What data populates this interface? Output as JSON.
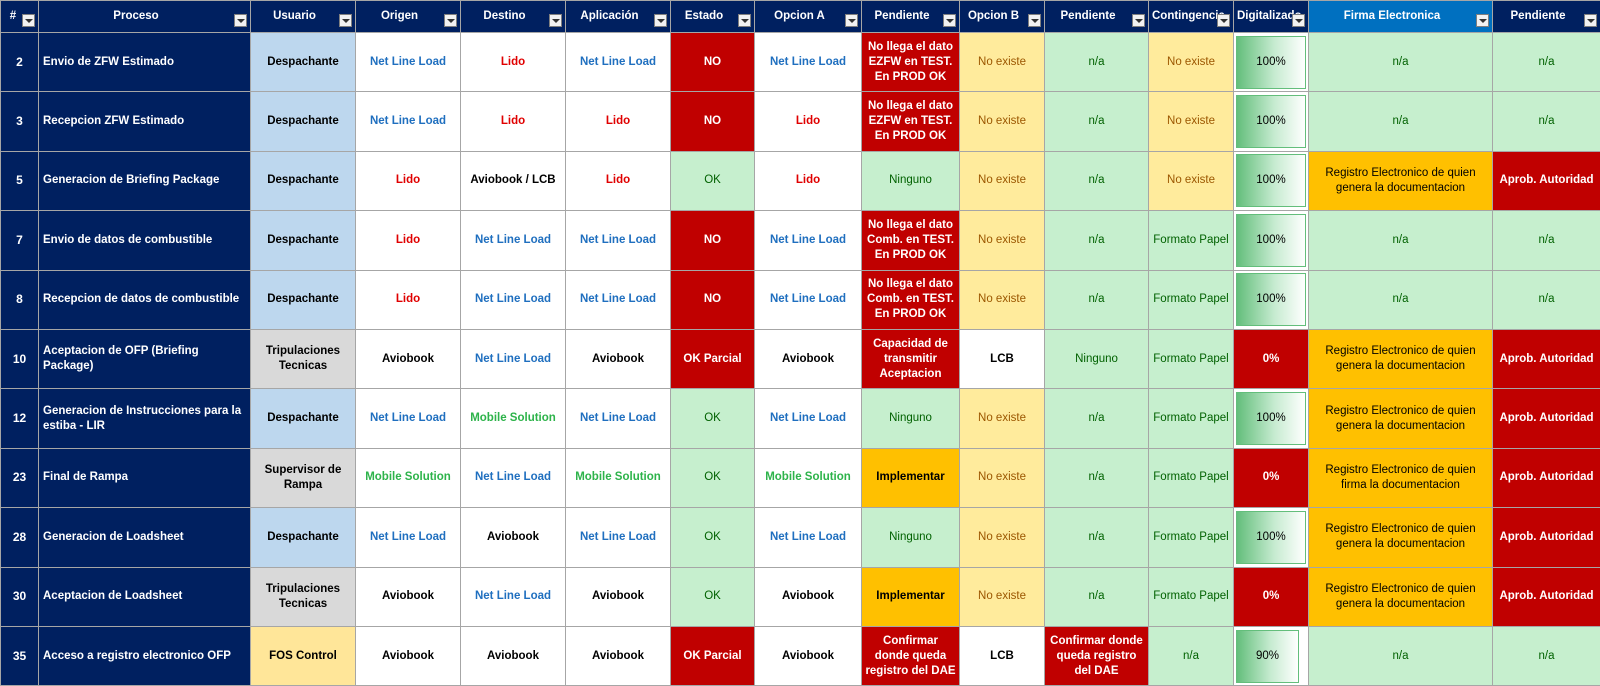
{
  "headers": {
    "num": "#",
    "proceso": "Proceso",
    "usuario": "Usuario",
    "origen": "Origen",
    "destino": "Destino",
    "aplicacion": "Aplicación",
    "estado": "Estado",
    "opcion_a": "Opcion A",
    "pendiente1": "Pendiente",
    "opcion_b": "Opcion B",
    "pendiente2": "Pendiente",
    "contingencia": "Contingencia",
    "digitalizado": "Digitalizado",
    "firma": "Firma Electronica",
    "pendiente3": "Pendiente"
  },
  "rows": [
    {
      "num": "2",
      "proceso": "Envio de ZFW Estimado",
      "usuario": "Despachante",
      "origen": "Net Line Load",
      "destino": "Lido",
      "aplicacion": "Net Line Load",
      "estado": "NO",
      "opcion_a": "Net Line Load",
      "pendiente1": "No llega el dato EZFW en TEST. En PROD OK",
      "opcion_b": "No existe",
      "pendiente2": "n/a",
      "contingencia": "No existe",
      "digitalizado": "100%",
      "firma": "n/a",
      "pendiente3": "n/a"
    },
    {
      "num": "3",
      "proceso": "Recepcion ZFW Estimado",
      "usuario": "Despachante",
      "origen": "Net Line Load",
      "destino": "Lido",
      "aplicacion": "Lido",
      "estado": "NO",
      "opcion_a": "Lido",
      "pendiente1": "No llega el dato EZFW en TEST. En PROD OK",
      "opcion_b": "No existe",
      "pendiente2": "n/a",
      "contingencia": "No existe",
      "digitalizado": "100%",
      "firma": "n/a",
      "pendiente3": "n/a"
    },
    {
      "num": "5",
      "proceso": "Generacion de Briefing Package",
      "usuario": "Despachante",
      "origen": "Lido",
      "destino": "Aviobook / LCB",
      "aplicacion": "Lido",
      "estado": "OK",
      "opcion_a": "Lido",
      "pendiente1": "Ninguno",
      "opcion_b": "No existe",
      "pendiente2": "n/a",
      "contingencia": "No existe",
      "digitalizado": "100%",
      "firma": "Registro Electronico de quien genera la documentacion",
      "pendiente3": "Aprob. Autoridad"
    },
    {
      "num": "7",
      "proceso": "Envio de datos de combustible",
      "usuario": "Despachante",
      "origen": "Lido",
      "destino": "Net Line Load",
      "aplicacion": "Net Line Load",
      "estado": "NO",
      "opcion_a": "Net Line Load",
      "pendiente1": "No llega el dato Comb. en TEST. En PROD OK",
      "opcion_b": "No existe",
      "pendiente2": "n/a",
      "contingencia": "Formato Papel",
      "digitalizado": "100%",
      "firma": "n/a",
      "pendiente3": "n/a"
    },
    {
      "num": "8",
      "proceso": "Recepcion de datos de combustible",
      "usuario": "Despachante",
      "origen": "Lido",
      "destino": "Net Line Load",
      "aplicacion": "Net Line Load",
      "estado": "NO",
      "opcion_a": "Net Line Load",
      "pendiente1": "No llega el dato Comb. en TEST. En PROD OK",
      "opcion_b": "No existe",
      "pendiente2": "n/a",
      "contingencia": "Formato Papel",
      "digitalizado": "100%",
      "firma": "n/a",
      "pendiente3": "n/a"
    },
    {
      "num": "10",
      "proceso": "Aceptacion de OFP (Briefing Package)",
      "usuario": "Tripulaciones Tecnicas",
      "origen": "Aviobook",
      "destino": "Net Line Load",
      "aplicacion": "Aviobook",
      "estado": "OK Parcial",
      "opcion_a": "Aviobook",
      "pendiente1": "Capacidad de transmitir Aceptacion",
      "opcion_b": "LCB",
      "pendiente2": "Ninguno",
      "contingencia": "Formato Papel",
      "digitalizado": "0%",
      "firma": "Registro Electronico de quien genera la documentacion",
      "pendiente3": "Aprob. Autoridad"
    },
    {
      "num": "12",
      "proceso": "Generacion de Instrucciones para la estiba - LIR",
      "usuario": "Despachante",
      "origen": "Net Line Load",
      "destino": "Mobile Solution",
      "aplicacion": "Net Line Load",
      "estado": "OK",
      "opcion_a": "Net Line Load",
      "pendiente1": "Ninguno",
      "opcion_b": "No existe",
      "pendiente2": "n/a",
      "contingencia": "Formato Papel",
      "digitalizado": "100%",
      "firma": "Registro Electronico de quien genera la documentacion",
      "pendiente3": "Aprob. Autoridad"
    },
    {
      "num": "23",
      "proceso": "Final de Rampa",
      "usuario": "Supervisor de Rampa",
      "origen": "Mobile Solution",
      "destino": "Net Line Load",
      "aplicacion": "Mobile Solution",
      "estado": "OK",
      "opcion_a": "Mobile Solution",
      "pendiente1": "Implementar",
      "opcion_b": "No existe",
      "pendiente2": "n/a",
      "contingencia": "Formato Papel",
      "digitalizado": "0%",
      "firma": "Registro Electronico de quien firma la documentacion",
      "pendiente3": "Aprob. Autoridad"
    },
    {
      "num": "28",
      "proceso": "Generacion de Loadsheet",
      "usuario": "Despachante",
      "origen": "Net Line Load",
      "destino": "Aviobook",
      "aplicacion": "Net Line Load",
      "estado": "OK",
      "opcion_a": "Net Line Load",
      "pendiente1": "Ninguno",
      "opcion_b": "No existe",
      "pendiente2": "n/a",
      "contingencia": "Formato Papel",
      "digitalizado": "100%",
      "firma": "Registro Electronico de quien genera la documentacion",
      "pendiente3": "Aprob. Autoridad"
    },
    {
      "num": "30",
      "proceso": "Aceptacion de Loadsheet",
      "usuario": "Tripulaciones Tecnicas",
      "origen": "Aviobook",
      "destino": "Net Line Load",
      "aplicacion": "Aviobook",
      "estado": "OK",
      "opcion_a": "Aviobook",
      "pendiente1": "Implementar",
      "opcion_b": "No existe",
      "pendiente2": "n/a",
      "contingencia": "Formato Papel",
      "digitalizado": "0%",
      "firma": "Registro Electronico de quien genera la documentacion",
      "pendiente3": "Aprob. Autoridad"
    },
    {
      "num": "35",
      "proceso": "Acceso a registro electronico OFP",
      "usuario": "FOS Control",
      "origen": "Aviobook",
      "destino": "Aviobook",
      "aplicacion": "Aviobook",
      "estado": "OK Parcial",
      "opcion_a": "Aviobook",
      "pendiente1": "Confirmar donde queda registro del DAE",
      "opcion_b": "LCB",
      "pendiente2": "Confirmar donde queda registro del DAE",
      "contingencia": "n/a",
      "digitalizado": "90%",
      "firma": "n/a",
      "pendiente3": "n/a"
    }
  ]
}
